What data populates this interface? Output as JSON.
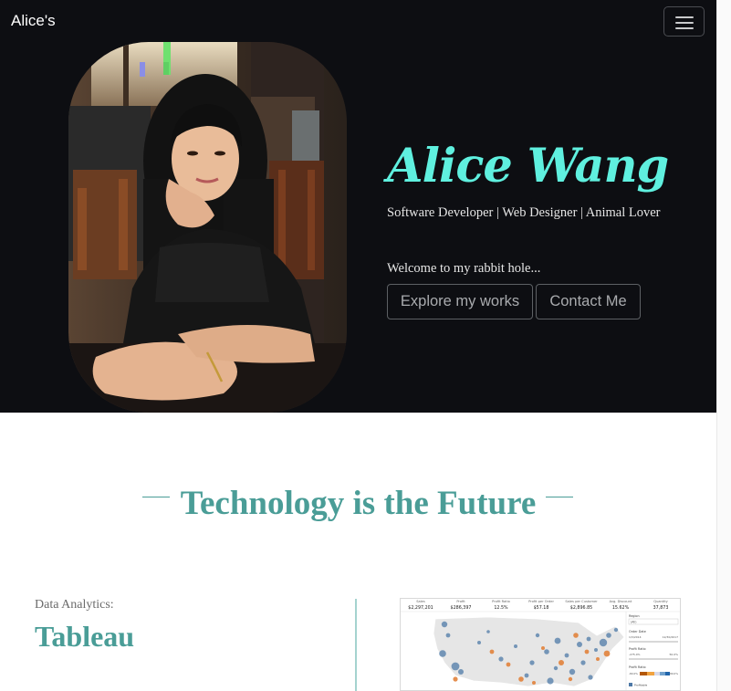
{
  "navbar": {
    "brand": "Alice's",
    "menu_icon": "hamburger-menu-icon"
  },
  "hero": {
    "name": "Alice Wang",
    "tagline": "Software Developer | Web Designer | Animal Lover",
    "welcome": "Welcome to my rabbit hole...",
    "buttons": {
      "works": "Explore my works",
      "contact": "Contact Me"
    },
    "colors": {
      "background": "#0d0e12",
      "name": "#5ff0df"
    }
  },
  "technology": {
    "title": "Technology is the Future",
    "accent": "#4a9d97"
  },
  "project": {
    "label": "Data Analytics:",
    "title": "Tableau"
  },
  "dashboard": {
    "kpis": [
      {
        "label": "Sales",
        "value": "$2,297,201"
      },
      {
        "label": "Profit",
        "value": "$286,397"
      },
      {
        "label": "Profit Ratio",
        "value": "12.5%"
      },
      {
        "label": "Profit per Order",
        "value": "$57.18"
      },
      {
        "label": "Sales per Customer",
        "value": "$2,896.85"
      },
      {
        "label": "Avg. Discount",
        "value": "15.62%"
      },
      {
        "label": "Quantity",
        "value": "37,873"
      }
    ],
    "filters": {
      "region": "Region",
      "region_value": "(All)",
      "order_date": "Order Date",
      "order_date_start": "1/3/2014",
      "order_date_end": "12/30/2017",
      "profit_ratio": "Profit Ratio",
      "profit_ratio_min": "-275.0%",
      "profit_ratio_max": "50.0%",
      "profit_ratio_scale_min": "-80.0%",
      "profit_ratio_scale_max": "80.0%",
      "legend_item": "Profitable"
    }
  }
}
